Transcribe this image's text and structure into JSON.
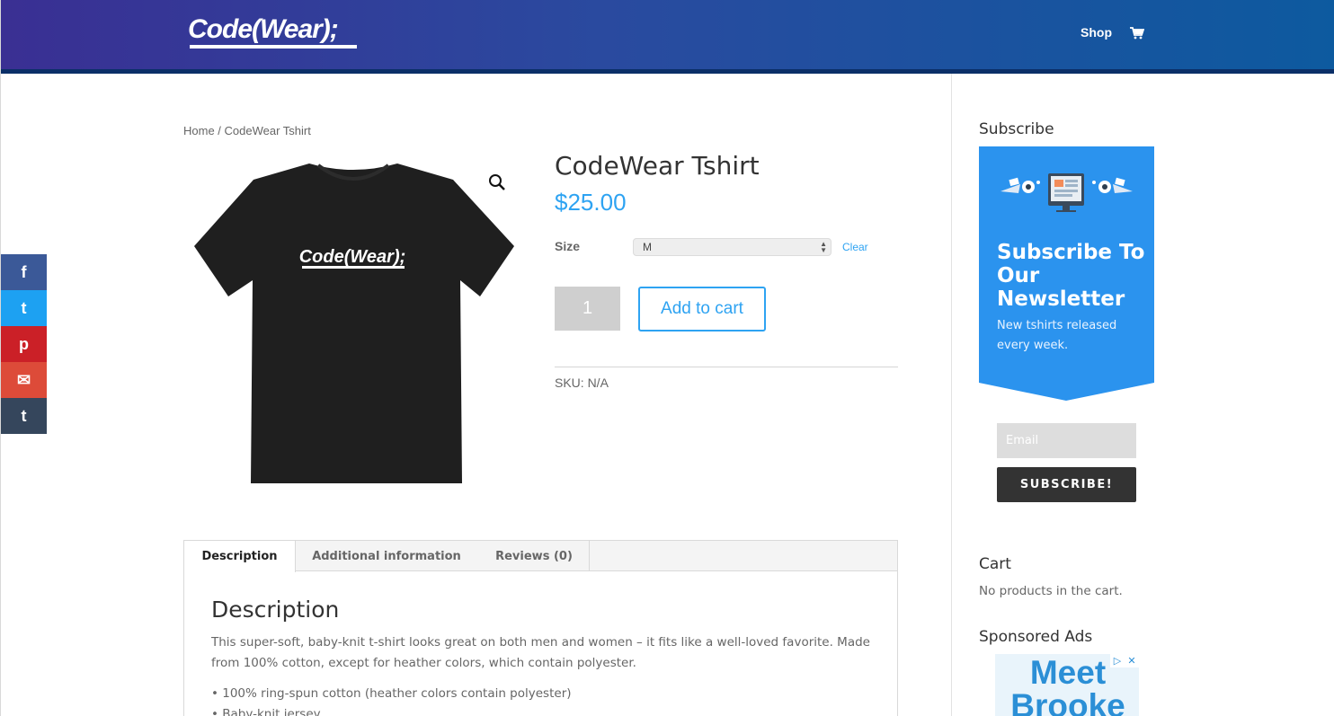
{
  "header": {
    "logo_text": "Code(Wear);",
    "nav": {
      "shop_label": "Shop"
    },
    "cart_icon": "shopping-cart-icon"
  },
  "social": {
    "items": [
      {
        "icon": "facebook-icon",
        "glyph": "f"
      },
      {
        "icon": "twitter-icon",
        "glyph": "t"
      },
      {
        "icon": "pinterest-icon",
        "glyph": "p"
      },
      {
        "icon": "email-icon",
        "glyph": "✉"
      },
      {
        "icon": "tumblr-icon",
        "glyph": "t"
      }
    ]
  },
  "breadcrumb": "Home / CodeWear Tshirt",
  "product": {
    "title": "CodeWear Tshirt",
    "price": "$25.00",
    "image_print": "Code(Wear);",
    "size_label": "Size",
    "size_value": "M",
    "clear_label": "Clear",
    "quantity": "1",
    "add_to_cart_label": "Add to cart",
    "sku": "SKU: N/A",
    "zoom_icon": "magnify-icon"
  },
  "tabs": [
    {
      "label": "Description",
      "active": true
    },
    {
      "label": "Additional information",
      "active": false
    },
    {
      "label": "Reviews (0)",
      "active": false
    }
  ],
  "description": {
    "title": "Description",
    "text": "This super-soft, baby-knit t-shirt looks great on both men and women – it fits like a well-loved favorite. Made from 100% cotton, except for heather colors, which contain polyester.",
    "bullets": [
      "• 100% ring-spun cotton (heather colors contain polyester)",
      "• Baby-knit jersey"
    ]
  },
  "sidebar": {
    "subscribe_heading": "Subscribe",
    "subscribe_title": "Subscribe To Our Newsletter",
    "subscribe_text": "New tshirts released every week.",
    "email_placeholder": "Email",
    "subscribe_button": "SUBSCRIBE!",
    "cart_heading": "Cart",
    "cart_text": "No products in the cart.",
    "ads_heading": "Sponsored Ads",
    "ad_text": "Meet Brooke",
    "ad_badges": [
      "▷",
      "✕"
    ]
  },
  "colors": {
    "accent": "#2ea3f2",
    "header_start": "#3a2f93",
    "header_end": "#0d5a9f",
    "subscribe_box": "#2b93ee"
  }
}
